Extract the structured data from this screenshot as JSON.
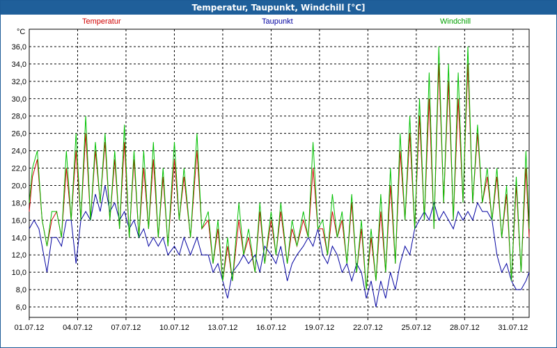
{
  "window": {
    "title": "Temperatur, Taupunkt, Windchill [°C]"
  },
  "chart_data": {
    "type": "line",
    "title": "Temperatur, Taupunkt, Windchill [°C]",
    "ylabel": "°C",
    "ylim": [
      4.8,
      38.0
    ],
    "y_ticks": [
      "6,0",
      "8,0",
      "10,0",
      "12,0",
      "14,0",
      "16,0",
      "18,0",
      "20,0",
      "22,0",
      "24,0",
      "26,0",
      "28,0",
      "30,0",
      "32,0",
      "34,0",
      "36,0"
    ],
    "x_ticks": [
      "01.07.12",
      "04.07.12",
      "07.07.12",
      "10.07.12",
      "13.07.12",
      "16.07.12",
      "19.07.12",
      "22.07.12",
      "25.07.12",
      "28.07.12",
      "31.07.12"
    ],
    "xlim_days": [
      1,
      32
    ],
    "grid": true,
    "series": [
      {
        "name": "Temperatur",
        "color": "#d00000",
        "points": [
          [
            1.0,
            17
          ],
          [
            1.2,
            21
          ],
          [
            1.5,
            23
          ],
          [
            1.8,
            16
          ],
          [
            2.1,
            13
          ],
          [
            2.4,
            16
          ],
          [
            2.7,
            17
          ],
          [
            3.0,
            14
          ],
          [
            3.3,
            22
          ],
          [
            3.6,
            16
          ],
          [
            3.9,
            24
          ],
          [
            4.2,
            16
          ],
          [
            4.5,
            26
          ],
          [
            4.8,
            16
          ],
          [
            5.1,
            24
          ],
          [
            5.4,
            18
          ],
          [
            5.7,
            25
          ],
          [
            6.0,
            16
          ],
          [
            6.3,
            23
          ],
          [
            6.6,
            15
          ],
          [
            6.9,
            25
          ],
          [
            7.2,
            14
          ],
          [
            7.5,
            23
          ],
          [
            7.8,
            14
          ],
          [
            8.1,
            22
          ],
          [
            8.4,
            15
          ],
          [
            8.7,
            23
          ],
          [
            9.0,
            14
          ],
          [
            9.3,
            21
          ],
          [
            9.6,
            13
          ],
          [
            10.0,
            23
          ],
          [
            10.3,
            16
          ],
          [
            10.6,
            21
          ],
          [
            11.0,
            14
          ],
          [
            11.4,
            24
          ],
          [
            11.7,
            15
          ],
          [
            12.1,
            16
          ],
          [
            12.4,
            11
          ],
          [
            12.7,
            15
          ],
          [
            13.0,
            9
          ],
          [
            13.3,
            13
          ],
          [
            13.6,
            9
          ],
          [
            14.0,
            16
          ],
          [
            14.3,
            12
          ],
          [
            14.6,
            14
          ],
          [
            15.0,
            10
          ],
          [
            15.3,
            17
          ],
          [
            15.6,
            11
          ],
          [
            16.0,
            16
          ],
          [
            16.3,
            12
          ],
          [
            16.6,
            17
          ],
          [
            17.0,
            11
          ],
          [
            17.3,
            15
          ],
          [
            17.6,
            13
          ],
          [
            18.0,
            16
          ],
          [
            18.3,
            14
          ],
          [
            18.6,
            22
          ],
          [
            18.9,
            15
          ],
          [
            19.2,
            15
          ],
          [
            19.5,
            12
          ],
          [
            19.8,
            17
          ],
          [
            20.1,
            14
          ],
          [
            20.4,
            16
          ],
          [
            20.7,
            11
          ],
          [
            21.0,
            18
          ],
          [
            21.3,
            10
          ],
          [
            21.6,
            15
          ],
          [
            21.9,
            8
          ],
          [
            22.2,
            14
          ],
          [
            22.5,
            9
          ],
          [
            22.8,
            17
          ],
          [
            23.1,
            10
          ],
          [
            23.4,
            20
          ],
          [
            23.7,
            11
          ],
          [
            24.0,
            24
          ],
          [
            24.3,
            16
          ],
          [
            24.6,
            26
          ],
          [
            24.9,
            15
          ],
          [
            25.2,
            28
          ],
          [
            25.5,
            16
          ],
          [
            25.8,
            30
          ],
          [
            26.1,
            15
          ],
          [
            26.4,
            34
          ],
          [
            26.7,
            18
          ],
          [
            27.0,
            32
          ],
          [
            27.3,
            16
          ],
          [
            27.6,
            30
          ],
          [
            27.9,
            18
          ],
          [
            28.2,
            34
          ],
          [
            28.5,
            18
          ],
          [
            28.8,
            26
          ],
          [
            29.1,
            18
          ],
          [
            29.4,
            21
          ],
          [
            29.7,
            16
          ],
          [
            30.0,
            21
          ],
          [
            30.3,
            14
          ],
          [
            30.6,
            19
          ],
          [
            30.9,
            9
          ],
          [
            31.2,
            20
          ],
          [
            31.5,
            10
          ],
          [
            31.8,
            22
          ],
          [
            32.0,
            14
          ]
        ]
      },
      {
        "name": "Taupunkt",
        "color": "#0000a0",
        "points": [
          [
            1.0,
            15
          ],
          [
            1.3,
            16
          ],
          [
            1.6,
            15
          ],
          [
            1.9,
            12
          ],
          [
            2.1,
            10
          ],
          [
            2.4,
            14
          ],
          [
            2.7,
            14
          ],
          [
            3.0,
            13
          ],
          [
            3.3,
            16
          ],
          [
            3.6,
            16
          ],
          [
            3.9,
            11
          ],
          [
            4.2,
            16
          ],
          [
            4.5,
            17
          ],
          [
            4.8,
            16
          ],
          [
            5.1,
            19
          ],
          [
            5.4,
            17
          ],
          [
            5.7,
            20
          ],
          [
            6.0,
            17
          ],
          [
            6.3,
            18
          ],
          [
            6.6,
            16
          ],
          [
            6.9,
            17
          ],
          [
            7.2,
            15
          ],
          [
            7.5,
            16
          ],
          [
            7.8,
            14
          ],
          [
            8.1,
            15
          ],
          [
            8.4,
            13
          ],
          [
            8.7,
            14
          ],
          [
            9.0,
            13
          ],
          [
            9.3,
            14
          ],
          [
            9.6,
            12
          ],
          [
            10.0,
            13
          ],
          [
            10.3,
            12
          ],
          [
            10.6,
            14
          ],
          [
            11.0,
            12
          ],
          [
            11.4,
            14
          ],
          [
            11.7,
            12
          ],
          [
            12.1,
            12
          ],
          [
            12.4,
            10
          ],
          [
            12.7,
            11
          ],
          [
            13.0,
            9
          ],
          [
            13.3,
            7
          ],
          [
            13.6,
            10
          ],
          [
            14.0,
            11
          ],
          [
            14.3,
            12
          ],
          [
            14.6,
            11
          ],
          [
            15.0,
            12
          ],
          [
            15.3,
            10
          ],
          [
            15.6,
            13
          ],
          [
            16.0,
            12
          ],
          [
            16.3,
            11
          ],
          [
            16.6,
            13
          ],
          [
            17.0,
            9
          ],
          [
            17.3,
            11
          ],
          [
            17.6,
            12
          ],
          [
            18.0,
            13
          ],
          [
            18.3,
            14
          ],
          [
            18.6,
            13
          ],
          [
            18.9,
            15
          ],
          [
            19.2,
            12
          ],
          [
            19.5,
            11
          ],
          [
            19.8,
            13
          ],
          [
            20.1,
            12
          ],
          [
            20.4,
            10
          ],
          [
            20.7,
            11
          ],
          [
            21.0,
            9
          ],
          [
            21.3,
            11
          ],
          [
            21.6,
            10
          ],
          [
            21.9,
            7
          ],
          [
            22.2,
            9
          ],
          [
            22.5,
            6
          ],
          [
            22.8,
            9
          ],
          [
            23.1,
            7
          ],
          [
            23.4,
            10
          ],
          [
            23.7,
            8
          ],
          [
            24.0,
            11
          ],
          [
            24.3,
            13
          ],
          [
            24.6,
            12
          ],
          [
            24.9,
            15
          ],
          [
            25.2,
            16
          ],
          [
            25.5,
            17
          ],
          [
            25.8,
            16
          ],
          [
            26.1,
            18
          ],
          [
            26.4,
            16
          ],
          [
            26.7,
            17
          ],
          [
            27.0,
            16
          ],
          [
            27.3,
            15
          ],
          [
            27.6,
            17
          ],
          [
            27.9,
            16
          ],
          [
            28.2,
            17
          ],
          [
            28.5,
            16
          ],
          [
            28.8,
            18
          ],
          [
            29.1,
            17
          ],
          [
            29.4,
            17
          ],
          [
            29.7,
            16
          ],
          [
            30.0,
            12
          ],
          [
            30.3,
            10
          ],
          [
            30.6,
            11
          ],
          [
            30.9,
            9
          ],
          [
            31.2,
            8
          ],
          [
            31.5,
            8
          ],
          [
            31.8,
            9
          ],
          [
            32.0,
            10
          ]
        ]
      },
      {
        "name": "Windchill",
        "color": "#00c000",
        "points": [
          [
            1.0,
            18
          ],
          [
            1.2,
            22
          ],
          [
            1.5,
            24
          ],
          [
            1.8,
            16
          ],
          [
            2.1,
            13
          ],
          [
            2.4,
            17
          ],
          [
            2.7,
            17
          ],
          [
            3.0,
            14
          ],
          [
            3.3,
            24
          ],
          [
            3.6,
            16
          ],
          [
            3.9,
            26
          ],
          [
            4.2,
            16
          ],
          [
            4.5,
            28
          ],
          [
            4.8,
            16
          ],
          [
            5.1,
            25
          ],
          [
            5.4,
            18
          ],
          [
            5.7,
            26
          ],
          [
            6.0,
            16
          ],
          [
            6.3,
            24
          ],
          [
            6.6,
            15
          ],
          [
            6.9,
            27
          ],
          [
            7.2,
            14
          ],
          [
            7.5,
            24
          ],
          [
            7.8,
            14
          ],
          [
            8.1,
            24
          ],
          [
            8.4,
            15
          ],
          [
            8.7,
            25
          ],
          [
            9.0,
            14
          ],
          [
            9.3,
            22
          ],
          [
            9.6,
            13
          ],
          [
            10.0,
            25
          ],
          [
            10.3,
            16
          ],
          [
            10.6,
            22
          ],
          [
            11.0,
            14
          ],
          [
            11.4,
            26
          ],
          [
            11.7,
            15
          ],
          [
            12.1,
            17
          ],
          [
            12.4,
            11
          ],
          [
            12.7,
            16
          ],
          [
            13.0,
            9
          ],
          [
            13.3,
            14
          ],
          [
            13.6,
            9
          ],
          [
            14.0,
            18
          ],
          [
            14.3,
            12
          ],
          [
            14.6,
            15
          ],
          [
            15.0,
            10
          ],
          [
            15.3,
            18
          ],
          [
            15.6,
            11
          ],
          [
            16.0,
            17
          ],
          [
            16.3,
            12
          ],
          [
            16.6,
            18
          ],
          [
            17.0,
            11
          ],
          [
            17.3,
            16
          ],
          [
            17.6,
            13
          ],
          [
            18.0,
            17
          ],
          [
            18.3,
            14
          ],
          [
            18.6,
            25
          ],
          [
            18.9,
            15
          ],
          [
            19.2,
            16
          ],
          [
            19.5,
            12
          ],
          [
            19.8,
            19
          ],
          [
            20.1,
            14
          ],
          [
            20.4,
            17
          ],
          [
            20.7,
            11
          ],
          [
            21.0,
            19
          ],
          [
            21.3,
            10
          ],
          [
            21.6,
            16
          ],
          [
            21.9,
            8
          ],
          [
            22.2,
            15
          ],
          [
            22.5,
            9
          ],
          [
            22.8,
            19
          ],
          [
            23.1,
            10
          ],
          [
            23.4,
            22
          ],
          [
            23.7,
            11
          ],
          [
            24.0,
            26
          ],
          [
            24.3,
            16
          ],
          [
            24.6,
            28
          ],
          [
            24.9,
            15
          ],
          [
            25.2,
            30
          ],
          [
            25.5,
            16
          ],
          [
            25.8,
            33
          ],
          [
            26.1,
            15
          ],
          [
            26.4,
            36
          ],
          [
            26.7,
            18
          ],
          [
            27.0,
            34
          ],
          [
            27.3,
            16
          ],
          [
            27.6,
            33
          ],
          [
            27.9,
            18
          ],
          [
            28.2,
            36
          ],
          [
            28.5,
            18
          ],
          [
            28.8,
            27
          ],
          [
            29.1,
            18
          ],
          [
            29.4,
            22
          ],
          [
            29.7,
            16
          ],
          [
            30.0,
            22
          ],
          [
            30.3,
            14
          ],
          [
            30.6,
            20
          ],
          [
            30.9,
            9
          ],
          [
            31.2,
            21
          ],
          [
            31.5,
            10
          ],
          [
            31.8,
            24
          ],
          [
            32.0,
            15
          ]
        ]
      }
    ]
  }
}
